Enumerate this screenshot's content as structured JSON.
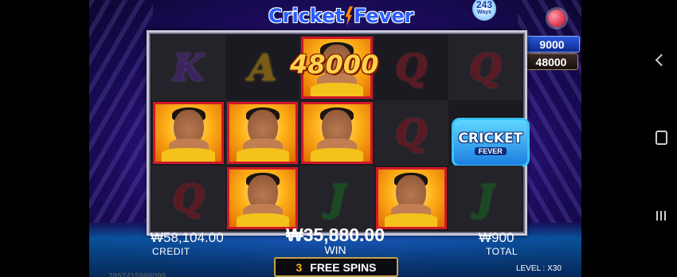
{
  "game": {
    "logo_main": "Cricket",
    "logo_second": "Fever",
    "logo_ways_num": "243",
    "logo_ways_label": "Ways",
    "big_win_text": "48000"
  },
  "jackpots": {
    "top_value": "9000",
    "bottom_value": "48000"
  },
  "reels": {
    "rows": [
      [
        "K",
        "A",
        "hero",
        "Q",
        "Q"
      ],
      [
        "hero",
        "hero",
        "hero",
        "Q",
        "scatter"
      ],
      [
        "Q",
        "hero",
        "J",
        "hero",
        "J"
      ]
    ],
    "scatter_line1": "CRICKET",
    "scatter_line2": "FEVER"
  },
  "stats": {
    "credit_amount": "₩58,104.00",
    "credit_label": "CREDIT",
    "win_amount": "₩35,880.00",
    "win_label": "WIN",
    "total_amount": "₩900",
    "total_label": "TOTAL"
  },
  "free_spins": {
    "count": "3",
    "label": "FREE SPINS"
  },
  "level_text": "LEVEL : X30",
  "bottom_digits": "7857415986098",
  "colors": {
    "accent_red": "#d0182a",
    "gold": "#ffd24a",
    "background": "#3a1a9a"
  }
}
